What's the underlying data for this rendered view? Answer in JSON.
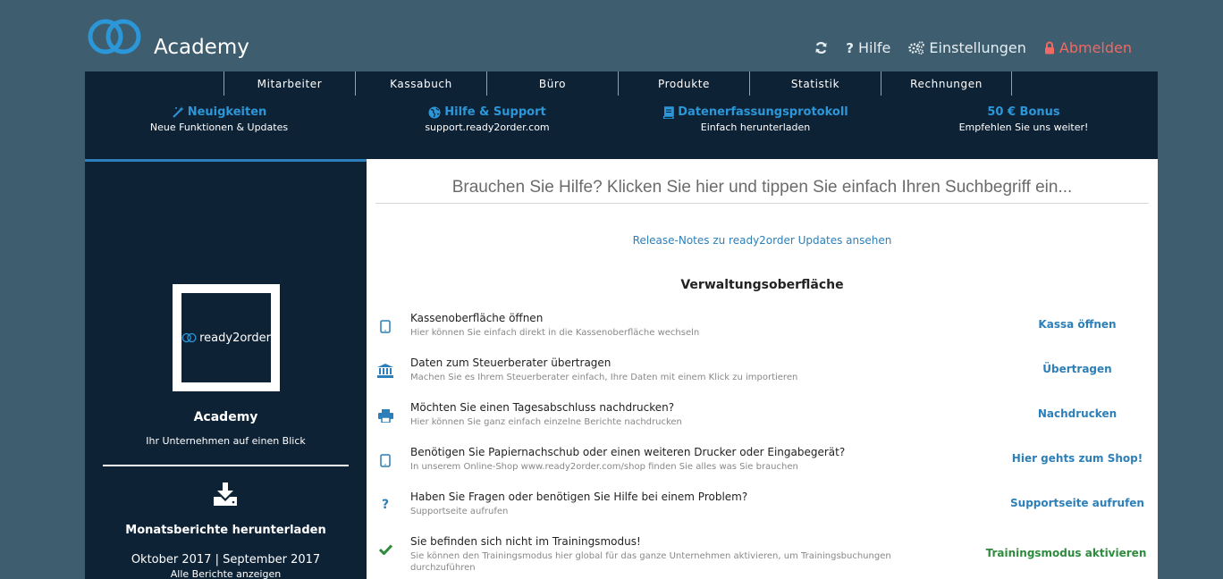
{
  "header": {
    "app_title": "Academy",
    "actions": {
      "refresh_icon": "refresh-icon",
      "help_label": "Hilfe",
      "settings_label": "Einstellungen",
      "logout_label": "Abmelden"
    }
  },
  "nav": {
    "items": [
      {
        "label": "Mitarbeiter"
      },
      {
        "label": "Kassabuch"
      },
      {
        "label": "Büro"
      },
      {
        "label": "Produkte"
      },
      {
        "label": "Statistik"
      },
      {
        "label": "Rechnungen"
      }
    ]
  },
  "features": [
    {
      "title": "Neuigkeiten",
      "subtitle": "Neue Funktionen & Updates",
      "icon": "magic-wand-icon"
    },
    {
      "title": "Hilfe & Support",
      "subtitle": "support.ready2order.com",
      "icon": "globe-icon"
    },
    {
      "title": "Datenerfassungsprotokoll",
      "subtitle": "Einfach herunterladen",
      "icon": "book-icon"
    },
    {
      "title": "50 € Bonus",
      "subtitle": "Empfehlen Sie uns weiter!",
      "icon": ""
    }
  ],
  "sidebar": {
    "logo_text": "ready2order",
    "company_name": "Academy",
    "company_sub": "Ihr Unternehmen auf einen Blick",
    "monthly_reports": "Monatsberichte herunterladen",
    "months": "Oktober 2017 | September 2017",
    "all_reports": "Alle Berichte anzeigen"
  },
  "main": {
    "search_placeholder": "Brauchen Sie Hilfe? Klicken Sie hier und tippen Sie einfach Ihren Suchbegriff ein...",
    "release_link": "Release-Notes zu ready2order Updates ansehen",
    "section_title": "Verwaltungsoberfläche",
    "rows": [
      {
        "icon": "tablet-icon",
        "title": "Kassenoberfläche öffnen",
        "desc": "Hier können Sie einfach direkt in die Kassenoberfläche wechseln",
        "action": "Kassa öffnen"
      },
      {
        "icon": "bank-icon",
        "title": "Daten zum Steuerberater übertragen",
        "desc": "Machen Sie es Ihrem Steuerberater einfach, Ihre Daten mit einem Klick zu importieren",
        "action": "Übertragen"
      },
      {
        "icon": "printer-icon",
        "title": "Möchten Sie einen Tagesabschluss nachdrucken?",
        "desc": "Hier können Sie ganz einfach einzelne Berichte nachdrucken",
        "action": "Nachdrucken"
      },
      {
        "icon": "tablet-icon",
        "title": "Benötigen Sie Papiernachschub oder einen weiteren Drucker oder Eingabegerät?",
        "desc": "In unserem Online-Shop www.ready2order.com/shop finden Sie alles was Sie brauchen",
        "action": "Hier gehts zum Shop!"
      },
      {
        "icon": "question-icon",
        "title": "Haben Sie Fragen oder benötigen Sie Hilfe bei einem Problem?",
        "desc": "Supportseite aufrufen",
        "action": "Supportseite aufrufen"
      },
      {
        "icon": "check-icon",
        "title": "Sie befinden sich nicht im Trainingsmodus!",
        "desc": "Sie können den Trainingsmodus hier global für das ganze Unternehmen aktivieren, um Trainingsbuchungen durchzuführen",
        "action": "Trainingsmodus aktivieren"
      }
    ]
  },
  "colors": {
    "background": "#3e5d6f",
    "panel": "#0e2236",
    "accent_blue": "#2c7fb8",
    "logout_red": "#ef6a62",
    "action_green": "#2e8b3d"
  }
}
